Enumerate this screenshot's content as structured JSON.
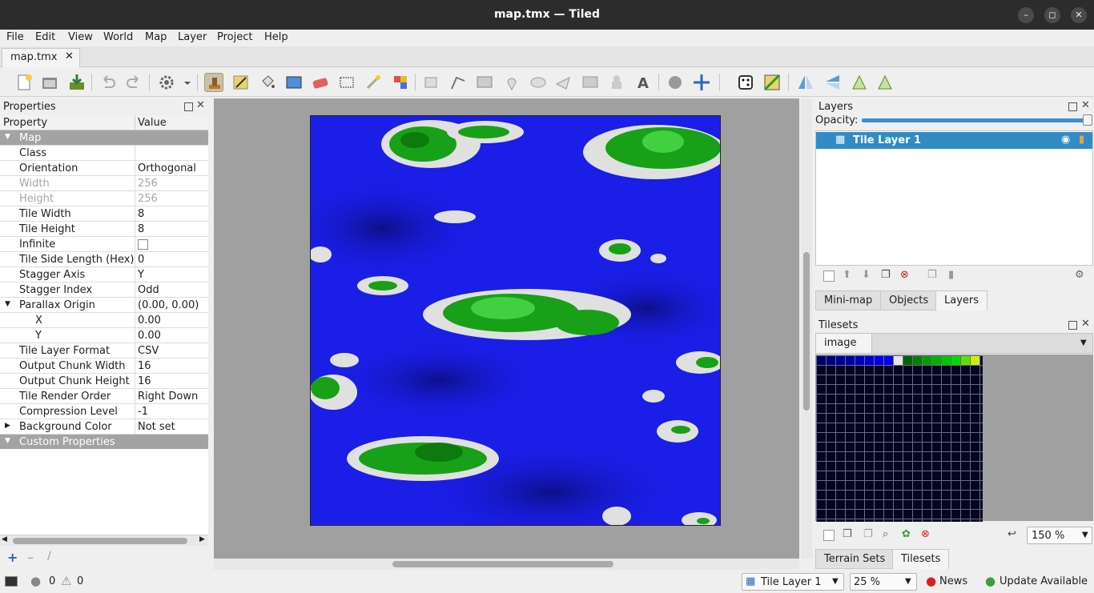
{
  "window": {
    "title": "map.tmx — Tiled"
  },
  "menu": [
    "File",
    "Edit",
    "View",
    "World",
    "Map",
    "Layer",
    "Project",
    "Help"
  ],
  "tab": {
    "label": "map.tmx"
  },
  "properties": {
    "title": "Properties",
    "col_property": "Property",
    "col_value": "Value",
    "rows": [
      {
        "k": "Map",
        "v": "",
        "type": "group"
      },
      {
        "k": "Class",
        "v": ""
      },
      {
        "k": "Orientation",
        "v": "Orthogonal"
      },
      {
        "k": "Width",
        "v": "256",
        "disabled": true
      },
      {
        "k": "Height",
        "v": "256",
        "disabled": true
      },
      {
        "k": "Tile Width",
        "v": "8"
      },
      {
        "k": "Tile Height",
        "v": "8"
      },
      {
        "k": "Infinite",
        "v": "",
        "type": "checkbox"
      },
      {
        "k": "Tile Side Length (Hex)",
        "v": "0"
      },
      {
        "k": "Stagger Axis",
        "v": "Y"
      },
      {
        "k": "Stagger Index",
        "v": "Odd"
      },
      {
        "k": "Parallax Origin",
        "v": "(0.00, 0.00)",
        "type": "expand"
      },
      {
        "k": "X",
        "v": "0.00",
        "indent": true
      },
      {
        "k": "Y",
        "v": "0.00",
        "indent": true
      },
      {
        "k": "Tile Layer Format",
        "v": "CSV"
      },
      {
        "k": "Output Chunk Width",
        "v": "16"
      },
      {
        "k": "Output Chunk Height",
        "v": "16"
      },
      {
        "k": "Tile Render Order",
        "v": "Right Down"
      },
      {
        "k": "Compression Level",
        "v": "-1"
      },
      {
        "k": "Background Color",
        "v": "Not set",
        "type": "collapsed"
      },
      {
        "k": "Custom Properties",
        "v": "",
        "type": "group"
      }
    ]
  },
  "layers": {
    "title": "Layers",
    "opacity_label": "Opacity:",
    "opacity": 1.0,
    "items": [
      {
        "name": "Tile Layer 1",
        "visible": true
      }
    ]
  },
  "layer_tabs": [
    "Mini-map",
    "Objects",
    "Layers"
  ],
  "tilesets": {
    "title": "Tilesets",
    "active": "image",
    "zoom": "150 %"
  },
  "tileset_tabs": [
    "Terrain Sets",
    "Tilesets"
  ],
  "status": {
    "errors": "0",
    "warnings": "0",
    "layer": "Tile Layer 1",
    "zoom": "25 %",
    "news": "News",
    "update": "Update Available"
  },
  "colors": {
    "accent": "#308cc6",
    "water": "#1a1ee6",
    "grass": "#16a116",
    "sand": "#dcdcdc"
  },
  "tileset_palette": [
    "#000064",
    "#000080",
    "#000096",
    "#0000aa",
    "#0000c0",
    "#0000d4",
    "#0000e6",
    "#0000ff",
    "#e6e6e6",
    "#006400",
    "#008000",
    "#00a000",
    "#00b400",
    "#00c800",
    "#00dc00",
    "#60e000",
    "#c8f000"
  ]
}
